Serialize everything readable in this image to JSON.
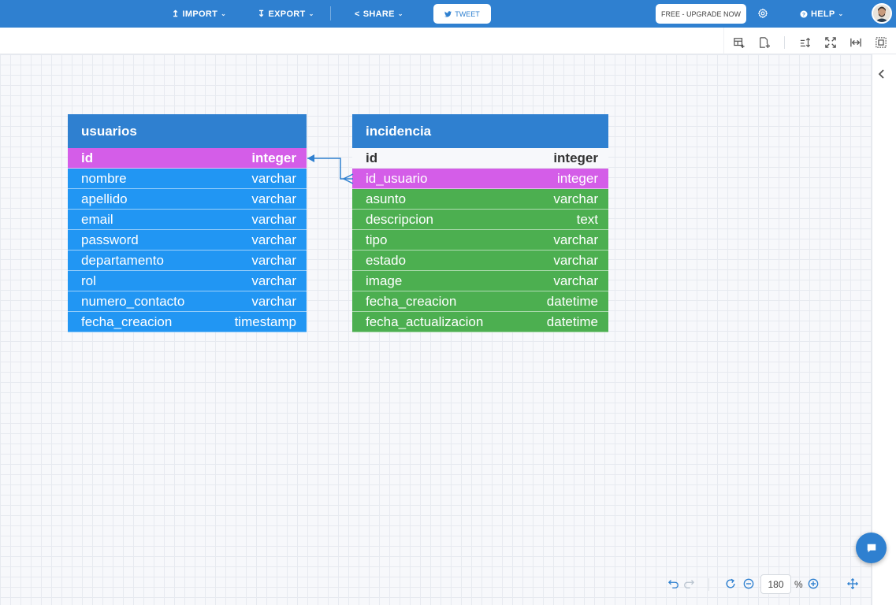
{
  "topbar": {
    "import_label": "IMPORT",
    "export_label": "EXPORT",
    "share_label": "SHARE",
    "tweet_label": "TWEET",
    "upgrade_label": "FREE - UPGRADE NOW",
    "help_label": "HELP"
  },
  "colors": {
    "brand": "#2f80d0",
    "pk_fk_row": "#d45de8",
    "usuarios_row": "#2196f3",
    "incidencia_row": "#4caf50"
  },
  "tables": {
    "usuarios": {
      "name": "usuarios",
      "columns": [
        {
          "name": "id",
          "type": "integer"
        },
        {
          "name": "nombre",
          "type": "varchar"
        },
        {
          "name": "apellido",
          "type": "varchar"
        },
        {
          "name": "email",
          "type": "varchar"
        },
        {
          "name": "password",
          "type": "varchar"
        },
        {
          "name": "departamento",
          "type": "varchar"
        },
        {
          "name": "rol",
          "type": "varchar"
        },
        {
          "name": "numero_contacto",
          "type": "varchar"
        },
        {
          "name": "fecha_creacion",
          "type": "timestamp"
        }
      ]
    },
    "incidencia": {
      "name": "incidencia",
      "columns": [
        {
          "name": "id",
          "type": "integer"
        },
        {
          "name": "id_usuario",
          "type": "integer"
        },
        {
          "name": "asunto",
          "type": "varchar"
        },
        {
          "name": "descripcion",
          "type": "text"
        },
        {
          "name": "tipo",
          "type": "varchar"
        },
        {
          "name": "estado",
          "type": "varchar"
        },
        {
          "name": "image",
          "type": "varchar"
        },
        {
          "name": "fecha_creacion",
          "type": "datetime"
        },
        {
          "name": "fecha_actualizacion",
          "type": "datetime"
        }
      ]
    }
  },
  "zoom": {
    "value": "180",
    "unit": "%"
  }
}
